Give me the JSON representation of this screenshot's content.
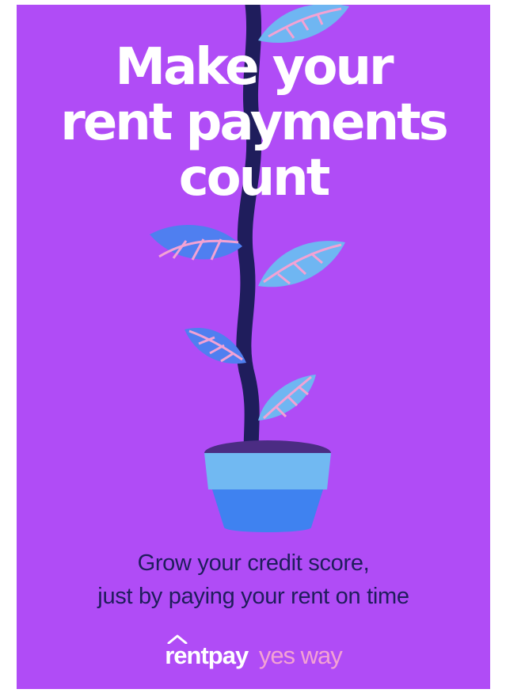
{
  "poster": {
    "headline": [
      "Make your",
      "rent payments",
      "count"
    ],
    "tagline": [
      "Grow your credit score,",
      "just by paying your rent on time"
    ],
    "brand": {
      "primary": "rentpay",
      "secondary": "yes way"
    },
    "colors": {
      "background": "#b04cf6",
      "headline": "#ffffff",
      "tagline": "#1f1d5c",
      "stem": "#1f1d5c",
      "leaf_light": "#6fb6f2",
      "leaf_blue": "#4f7ff0",
      "leaf_vein": "#f3a2d4",
      "pot_rim": "#71b9f2",
      "pot_body": "#3f82f0",
      "soil": "#4b2c83",
      "brand_secondary": "#f3a2d4"
    }
  }
}
